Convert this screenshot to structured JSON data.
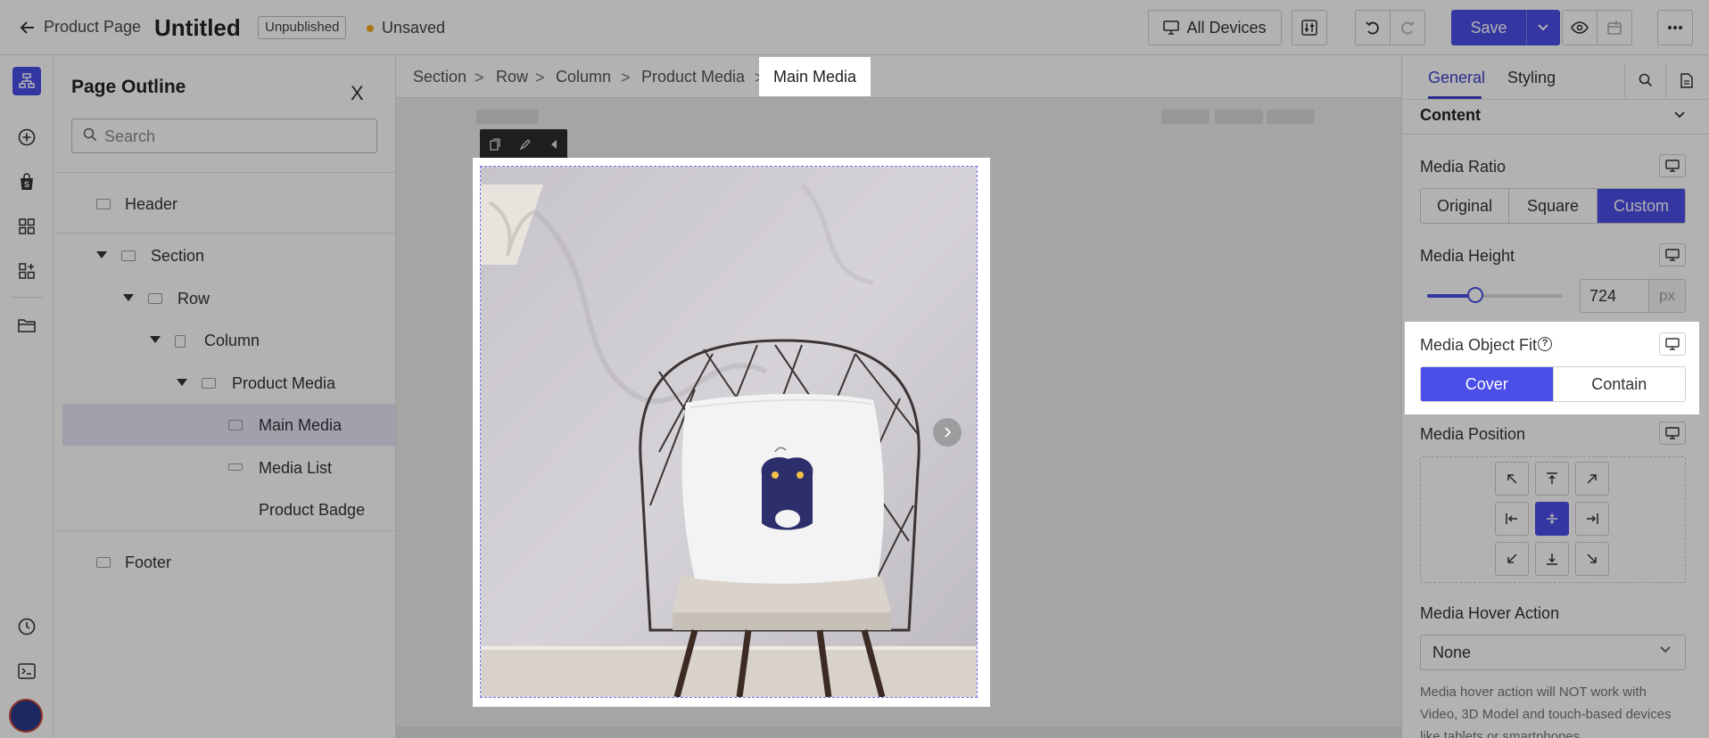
{
  "topbar": {
    "back_label": "Product Page",
    "title": "Untitled",
    "status_badge": "Unpublished",
    "save_state": "Unsaved",
    "device_label": "All Devices",
    "save_label": "Save"
  },
  "outline": {
    "title": "Page Outline",
    "close_label": "X",
    "search_placeholder": "Search",
    "items": [
      {
        "label": "Header"
      },
      {
        "label": "Section"
      },
      {
        "label": "Row"
      },
      {
        "label": "Column"
      },
      {
        "label": "Product Media"
      },
      {
        "label": "Main Media"
      },
      {
        "label": "Media List"
      },
      {
        "label": "Product Badge"
      },
      {
        "label": "Footer"
      }
    ]
  },
  "breadcrumb": {
    "items": [
      "Section",
      "Row",
      "Column",
      "Product Media"
    ],
    "current": "Main Media"
  },
  "panel": {
    "tabs": [
      "General",
      "Styling"
    ],
    "section_title": "Content",
    "media_ratio": {
      "label": "Media Ratio",
      "options": [
        "Original",
        "Square",
        "Custom"
      ],
      "selected": "Custom"
    },
    "media_height": {
      "label": "Media Height",
      "value": "724",
      "unit": "px",
      "slider_fraction": 0.35
    },
    "object_fit": {
      "label": "Media Object Fit",
      "help_icon": "?",
      "options": [
        "Cover",
        "Contain"
      ],
      "selected": "Cover"
    },
    "media_position": {
      "label": "Media Position",
      "selected": "center"
    },
    "hover_action": {
      "label": "Media Hover Action",
      "value": "None",
      "help": "Media hover action will NOT work with Video, 3D Model and touch-based devices like tablets or smartphones."
    }
  },
  "colors": {
    "accent": "#4b4ee8",
    "tab_active": "#3d40c8",
    "unsaved_dot": "#f5a623"
  }
}
